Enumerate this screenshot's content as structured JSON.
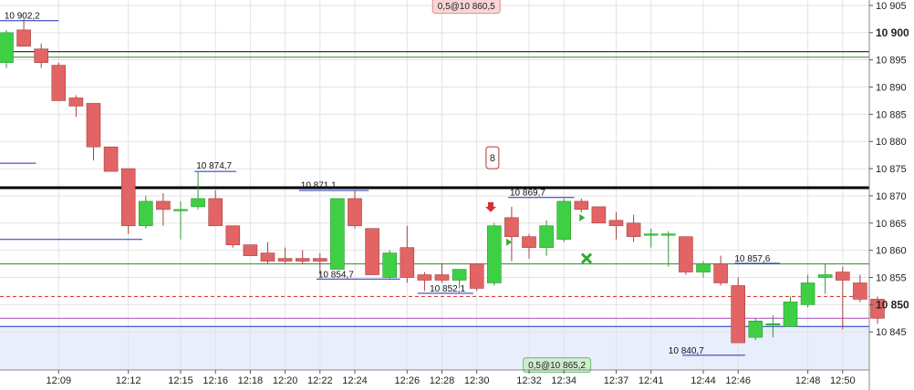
{
  "colors": {
    "up": "#3fcf45",
    "down": "#e26464",
    "up_edge": "#2b9a2f",
    "down_edge": "#a84040",
    "grid": "#e3e3e3",
    "blue_line": "#1f2fbf",
    "green_line": "#2f8a2f",
    "black_line": "#000000",
    "red_dashed": "#d02020",
    "purple_line": "#b04ab8",
    "zone_fill": "#e8eefb"
  },
  "chart_data": {
    "type": "candlestick",
    "ylim": [
      10838,
      10906
    ],
    "y_ticks": [
      10845,
      10850,
      10855,
      10860,
      10865,
      10870,
      10875,
      10880,
      10885,
      10890,
      10895,
      10900,
      10905
    ],
    "y_tick_labels": [
      "10 845",
      "10 850",
      "10 855",
      "10 860",
      "10 865",
      "10 870",
      "10 875",
      "10 880",
      "10 885",
      "10 890",
      "10 895",
      "10 900",
      "10 905"
    ],
    "y_bold_ticks": [
      10850,
      10900
    ],
    "x_tick_labels": [
      "12:09",
      "12:12",
      "12:15",
      "12:16",
      "12:18",
      "12:20",
      "12:22",
      "12:24",
      "12:26",
      "12:28",
      "12:30",
      "12:32",
      "12:34",
      "12:37",
      "12:41",
      "12:44",
      "12:46",
      "12:48",
      "12:50"
    ],
    "x_tick_index": [
      3,
      7,
      10,
      12,
      14,
      16,
      18,
      20,
      23,
      25,
      27,
      30,
      32,
      35,
      37,
      40,
      42,
      46,
      48
    ],
    "candles": [
      {
        "o": 10894.5,
        "h": 10900.5,
        "l": 10893.5,
        "c": 10900
      },
      {
        "o": 10900.5,
        "h": 10902.5,
        "l": 10897.5,
        "c": 10897.5
      },
      {
        "o": 10897,
        "h": 10898,
        "l": 10893.5,
        "c": 10894.5
      },
      {
        "o": 10894,
        "h": 10894.5,
        "l": 10887.5,
        "c": 10887.5
      },
      {
        "o": 10888,
        "h": 10888.5,
        "l": 10884.5,
        "c": 10886.5
      },
      {
        "o": 10887,
        "h": 10887,
        "l": 10876.5,
        "c": 10879
      },
      {
        "o": 10879,
        "h": 10879,
        "l": 10874.5,
        "c": 10874.5
      },
      {
        "o": 10875,
        "h": 10875,
        "l": 10863,
        "c": 10864.5
      },
      {
        "o": 10864.5,
        "h": 10870,
        "l": 10864,
        "c": 10869
      },
      {
        "o": 10869,
        "h": 10870.5,
        "l": 10864.5,
        "c": 10867.5
      },
      {
        "o": 10867.5,
        "h": 10869,
        "l": 10862,
        "c": 10867.5
      },
      {
        "o": 10868,
        "h": 10874.5,
        "l": 10867.5,
        "c": 10869.5
      },
      {
        "o": 10869.5,
        "h": 10871,
        "l": 10864.5,
        "c": 10864.5
      },
      {
        "o": 10864.5,
        "h": 10864.5,
        "l": 10860.5,
        "c": 10861
      },
      {
        "o": 10861,
        "h": 10861,
        "l": 10859,
        "c": 10859
      },
      {
        "o": 10859.5,
        "h": 10861.5,
        "l": 10857.5,
        "c": 10858
      },
      {
        "o": 10858.5,
        "h": 10860.5,
        "l": 10857.5,
        "c": 10858
      },
      {
        "o": 10858.5,
        "h": 10860,
        "l": 10857.5,
        "c": 10858
      },
      {
        "o": 10858.5,
        "h": 10859.5,
        "l": 10855.5,
        "c": 10858
      },
      {
        "o": 10856.5,
        "h": 10869.5,
        "l": 10856.5,
        "c": 10869.5
      },
      {
        "o": 10869.5,
        "h": 10871,
        "l": 10864,
        "c": 10864.5
      },
      {
        "o": 10864,
        "h": 10864,
        "l": 10855.5,
        "c": 10855.5
      },
      {
        "o": 10855,
        "h": 10860,
        "l": 10854.5,
        "c": 10859.5
      },
      {
        "o": 10860.5,
        "h": 10864.5,
        "l": 10854,
        "c": 10855
      },
      {
        "o": 10855.5,
        "h": 10856,
        "l": 10852.5,
        "c": 10854.5
      },
      {
        "o": 10855.5,
        "h": 10857.5,
        "l": 10854,
        "c": 10854.5
      },
      {
        "o": 10854.5,
        "h": 10856.5,
        "l": 10853,
        "c": 10856.5
      },
      {
        "o": 10857.5,
        "h": 10857.5,
        "l": 10852.5,
        "c": 10853
      },
      {
        "o": 10854,
        "h": 10865,
        "l": 10853.5,
        "c": 10864.5
      },
      {
        "o": 10866,
        "h": 10868,
        "l": 10858,
        "c": 10862.5
      },
      {
        "o": 10862.5,
        "h": 10863,
        "l": 10858.5,
        "c": 10860.5
      },
      {
        "o": 10860.5,
        "h": 10865.5,
        "l": 10859,
        "c": 10864.5
      },
      {
        "o": 10862,
        "h": 10869.5,
        "l": 10861.5,
        "c": 10869
      },
      {
        "o": 10869,
        "h": 10869.5,
        "l": 10867,
        "c": 10867.5
      },
      {
        "o": 10868,
        "h": 10868,
        "l": 10865,
        "c": 10865
      },
      {
        "o": 10865.5,
        "h": 10867,
        "l": 10862,
        "c": 10864.5
      },
      {
        "o": 10865,
        "h": 10866.5,
        "l": 10861.5,
        "c": 10862.5
      },
      {
        "o": 10863,
        "h": 10864,
        "l": 10860.5,
        "c": 10863
      },
      {
        "o": 10863,
        "h": 10863.5,
        "l": 10857,
        "c": 10863
      },
      {
        "o": 10862.5,
        "h": 10862.5,
        "l": 10855.5,
        "c": 10856
      },
      {
        "o": 10856,
        "h": 10858,
        "l": 10855,
        "c": 10857.5
      },
      {
        "o": 10857.5,
        "h": 10859,
        "l": 10853.5,
        "c": 10854
      },
      {
        "o": 10853.5,
        "h": 10855,
        "l": 10843,
        "c": 10843
      },
      {
        "o": 10844,
        "h": 10847.5,
        "l": 10843.5,
        "c": 10847
      },
      {
        "o": 10846.5,
        "h": 10848,
        "l": 10844,
        "c": 10846.5
      },
      {
        "o": 10846,
        "h": 10851.5,
        "l": 10846,
        "c": 10850.5
      },
      {
        "o": 10850,
        "h": 10855.5,
        "l": 10849.5,
        "c": 10854
      },
      {
        "o": 10855,
        "h": 10857.5,
        "l": 10852,
        "c": 10855.5
      },
      {
        "o": 10856,
        "h": 10857,
        "l": 10845.5,
        "c": 10854.5
      },
      {
        "o": 10854,
        "h": 10855.5,
        "l": 10850.5,
        "c": 10851
      },
      {
        "o": 10851,
        "h": 10851.5,
        "l": 10846.5,
        "c": 10847.5
      }
    ],
    "horizontal_lines": [
      {
        "y": 10871.5,
        "color": "black_line",
        "width": 3
      },
      {
        "y": 10896.5,
        "color": "black_line",
        "width": 1
      },
      {
        "y": 10895.5,
        "color": "green_line",
        "width": 1
      },
      {
        "y": 10857.5,
        "color": "green_line",
        "width": 1
      },
      {
        "y": 10847.5,
        "color": "purple_line",
        "width": 1
      },
      {
        "y": 10846,
        "color": "blue_line",
        "width": 1
      },
      {
        "y": 10851.5,
        "color": "red_dashed",
        "width": 1,
        "dashed": true
      }
    ],
    "zone": {
      "from": 10846,
      "to": 10838,
      "color": "zone_fill"
    },
    "level_segments": [
      {
        "y": 10876,
        "x1": 0,
        "x2": 1.7
      },
      {
        "y": 10862,
        "x1": 0,
        "x2": 7.8
      },
      {
        "y": 10874.5,
        "x1": 10.8,
        "x2": 13.2
      },
      {
        "y": 10871,
        "x1": 16.8,
        "x2": 20.8
      },
      {
        "y": 10854.7,
        "x1": 17.8,
        "x2": 22.6
      },
      {
        "y": 10852.1,
        "x1": 23.6,
        "x2": 26.8
      },
      {
        "y": 10869.7,
        "x1": 28.8,
        "x2": 32.6
      },
      {
        "y": 10840.7,
        "x1": 38.8,
        "x2": 42.4
      },
      {
        "y": 10857.6,
        "x1": 41.8,
        "x2": 44.4
      },
      {
        "y": 10902.2,
        "x1": 0,
        "x2": 3
      }
    ],
    "annotations": [
      {
        "label": "10 902,2",
        "y": 10902.2,
        "x": 0.2
      },
      {
        "label": "10 874,7",
        "y": 10874.7,
        "x": 10.9
      },
      {
        "label": "10 871,1",
        "y": 10871.1,
        "x": 16.9
      },
      {
        "label": "10 854,7",
        "y": 10854.7,
        "x": 17.9
      },
      {
        "label": "10 852,1",
        "y": 10852.1,
        "x": 24.3
      },
      {
        "label": "10 869,7",
        "y": 10869.7,
        "x": 28.9
      },
      {
        "label": "10 857,6",
        "y": 10857.6,
        "x": 41.8
      },
      {
        "label": "10 840,7",
        "y": 10840.7,
        "x": 38.0
      }
    ],
    "badges": [
      {
        "label": "0,5@10 860,5",
        "y": 10904.9,
        "x": 26.4,
        "kind": "sell"
      },
      {
        "label": "0,5@10 865,2",
        "y": 10838.9,
        "x": 31.6,
        "kind": "buy"
      }
    ],
    "count_box": {
      "label": "8",
      "y": 10877,
      "x": 27.9
    },
    "markers": [
      {
        "type": "arrow-down",
        "x": 27.8,
        "y": 10867.5
      },
      {
        "type": "triangle-right",
        "x": 28.8,
        "y": 10861.5
      },
      {
        "type": "triangle-right",
        "x": 33.0,
        "y": 10866
      },
      {
        "type": "cross",
        "x": 33.3,
        "y": 10858.5
      }
    ]
  }
}
